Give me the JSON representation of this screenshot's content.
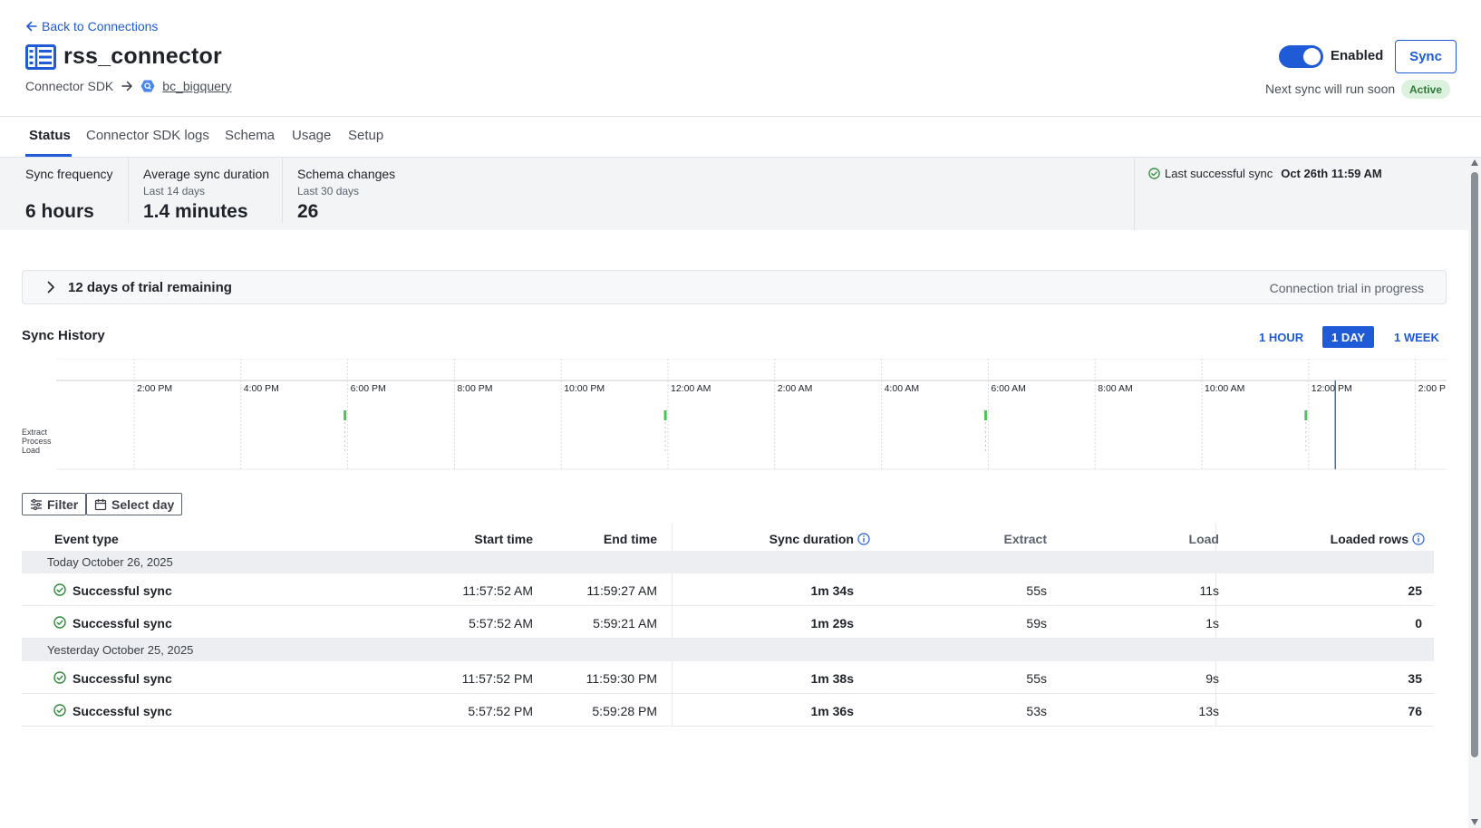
{
  "header": {
    "back_label": "Back to Connections",
    "title": "rss_connector",
    "source": "Connector SDK",
    "destination": "bc_bigquery",
    "enabled_label": "Enabled",
    "sync_label": "Sync",
    "next_sync": "Next sync will run soon",
    "status_badge": "Active",
    "enabled": true
  },
  "tabs": [
    {
      "label": "Status",
      "active": true
    },
    {
      "label": "Connector SDK logs",
      "active": false
    },
    {
      "label": "Schema",
      "active": false
    },
    {
      "label": "Usage",
      "active": false
    },
    {
      "label": "Setup",
      "active": false
    }
  ],
  "stats": {
    "sync_frequency": {
      "label": "Sync frequency",
      "value": "6 hours"
    },
    "avg_duration": {
      "label": "Average sync duration",
      "sub": "Last 14 days",
      "value": "1.4 minutes"
    },
    "schema_changes": {
      "label": "Schema changes",
      "sub": "Last 30 days",
      "value": "26"
    },
    "last_sync": {
      "label": "Last successful sync",
      "value": "Oct 26th 11:59 AM"
    }
  },
  "trial": {
    "label": "12 days of trial remaining",
    "status": "Connection trial in progress"
  },
  "sync_history": {
    "title": "Sync History",
    "ranges": [
      {
        "label": "1 HOUR",
        "active": false
      },
      {
        "label": "1 DAY",
        "active": true
      },
      {
        "label": "1 WEEK",
        "active": false
      }
    ],
    "row_labels": [
      "Extract",
      "Process",
      "Load"
    ],
    "time_ticks": [
      "2:00 PM",
      "4:00 PM",
      "6:00 PM",
      "8:00 PM",
      "10:00 PM",
      "12:00 AM",
      "2:00 AM",
      "4:00 AM",
      "6:00 AM",
      "8:00 AM",
      "10:00 AM",
      "12:00 PM",
      "2:00 P"
    ],
    "sync_marks": [
      "5:57 PM",
      "11:57 PM",
      "5:57 AM",
      "11:57 AM"
    ],
    "now_marker": "12:30 PM"
  },
  "filters": {
    "filter_label": "Filter",
    "select_day_label": "Select day"
  },
  "table": {
    "columns": {
      "event_type": "Event type",
      "start_time": "Start time",
      "end_time": "End time",
      "sync_duration": "Sync duration",
      "extract": "Extract",
      "load": "Load",
      "loaded_rows": "Loaded rows"
    },
    "groups": [
      {
        "date": "Today October 26, 2025",
        "rows": [
          {
            "event": "Successful sync",
            "start": "11:57:52 AM",
            "end": "11:59:27 AM",
            "duration": "1m 34s",
            "extract": "55s",
            "load": "11s",
            "rows": "25"
          },
          {
            "event": "Successful sync",
            "start": "5:57:52 AM",
            "end": "5:59:21 AM",
            "duration": "1m 29s",
            "extract": "59s",
            "load": "1s",
            "rows": "0"
          }
        ]
      },
      {
        "date": "Yesterday October 25, 2025",
        "rows": [
          {
            "event": "Successful sync",
            "start": "11:57:52 PM",
            "end": "11:59:30 PM",
            "duration": "1m 38s",
            "extract": "55s",
            "load": "9s",
            "rows": "35"
          },
          {
            "event": "Successful sync",
            "start": "5:57:52 PM",
            "end": "5:59:28 PM",
            "duration": "1m 36s",
            "extract": "53s",
            "load": "13s",
            "rows": "76"
          }
        ]
      }
    ]
  },
  "colors": {
    "accent": "#1f5bd6",
    "success": "#2f8a3a",
    "sync_mark": "#4cc35a",
    "badge_bg": "#dcf1de"
  }
}
